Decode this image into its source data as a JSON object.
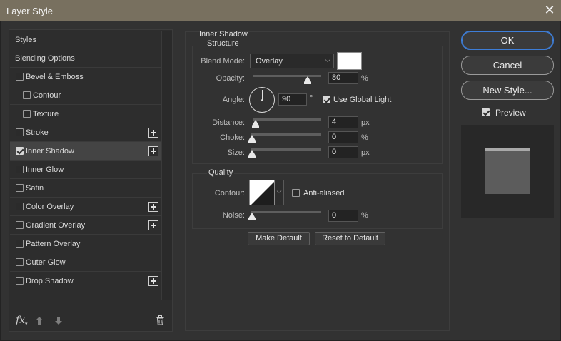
{
  "window": {
    "title": "Layer Style",
    "close_glyph": "✕"
  },
  "styles_list": [
    {
      "label": "Styles",
      "checkbox": false,
      "checked": false,
      "plus": false,
      "indent": 0
    },
    {
      "label": "Blending Options",
      "checkbox": false,
      "checked": false,
      "plus": false,
      "indent": 0
    },
    {
      "label": "Bevel & Emboss",
      "checkbox": true,
      "checked": false,
      "plus": false,
      "indent": 0
    },
    {
      "label": "Contour",
      "checkbox": true,
      "checked": false,
      "plus": false,
      "indent": 1
    },
    {
      "label": "Texture",
      "checkbox": true,
      "checked": false,
      "plus": false,
      "indent": 1
    },
    {
      "label": "Stroke",
      "checkbox": true,
      "checked": false,
      "plus": true,
      "indent": 0
    },
    {
      "label": "Inner Shadow",
      "checkbox": true,
      "checked": true,
      "plus": true,
      "indent": 0,
      "selected": true
    },
    {
      "label": "Inner Glow",
      "checkbox": true,
      "checked": false,
      "plus": false,
      "indent": 0
    },
    {
      "label": "Satin",
      "checkbox": true,
      "checked": false,
      "plus": false,
      "indent": 0
    },
    {
      "label": "Color Overlay",
      "checkbox": true,
      "checked": false,
      "plus": true,
      "indent": 0
    },
    {
      "label": "Gradient Overlay",
      "checkbox": true,
      "checked": false,
      "plus": true,
      "indent": 0
    },
    {
      "label": "Pattern Overlay",
      "checkbox": true,
      "checked": false,
      "plus": false,
      "indent": 0
    },
    {
      "label": "Outer Glow",
      "checkbox": true,
      "checked": false,
      "plus": false,
      "indent": 0
    },
    {
      "label": "Drop Shadow",
      "checkbox": true,
      "checked": false,
      "plus": true,
      "indent": 0
    }
  ],
  "bottom_bar": {
    "fx_label": "fx",
    "fx_caret": "▾",
    "move_up_glyph": "🡅",
    "move_down_glyph": "🡇",
    "icons": [
      "fx-icon",
      "move-up-icon",
      "move-down-icon",
      "trash-icon"
    ]
  },
  "inner_shadow": {
    "section_title": "Inner Shadow",
    "structure_title": "Structure",
    "blend_mode": {
      "label": "Blend Mode:",
      "value": "Overlay",
      "color": "#ffffff"
    },
    "opacity": {
      "label": "Opacity:",
      "value": "80",
      "unit": "%",
      "level": 0.8
    },
    "angle": {
      "label": "Angle:",
      "value": "90",
      "unit": "°",
      "use_global_light_label": "Use Global Light",
      "use_global_light": true
    },
    "distance": {
      "label": "Distance:",
      "value": "4",
      "unit": "px",
      "level": 0.0
    },
    "choke": {
      "label": "Choke:",
      "value": "0",
      "unit": "%",
      "level": 0.0
    },
    "size": {
      "label": "Size:",
      "value": "0",
      "unit": "px",
      "level": 0.0
    },
    "quality_title": "Quality",
    "contour": {
      "label": "Contour:",
      "anti_aliased_label": "Anti-aliased",
      "anti_aliased": false
    },
    "noise": {
      "label": "Noise:",
      "value": "0",
      "unit": "%",
      "level": 0.0
    },
    "make_default_label": "Make Default",
    "reset_default_label": "Reset to Default"
  },
  "actions": {
    "ok_label": "OK",
    "cancel_label": "Cancel",
    "new_style_label": "New Style...",
    "preview_label": "Preview",
    "preview_checked": true
  },
  "colors": {
    "accent": "#3e7ed8",
    "titlebar": "#78705f",
    "panel": "#323232"
  }
}
